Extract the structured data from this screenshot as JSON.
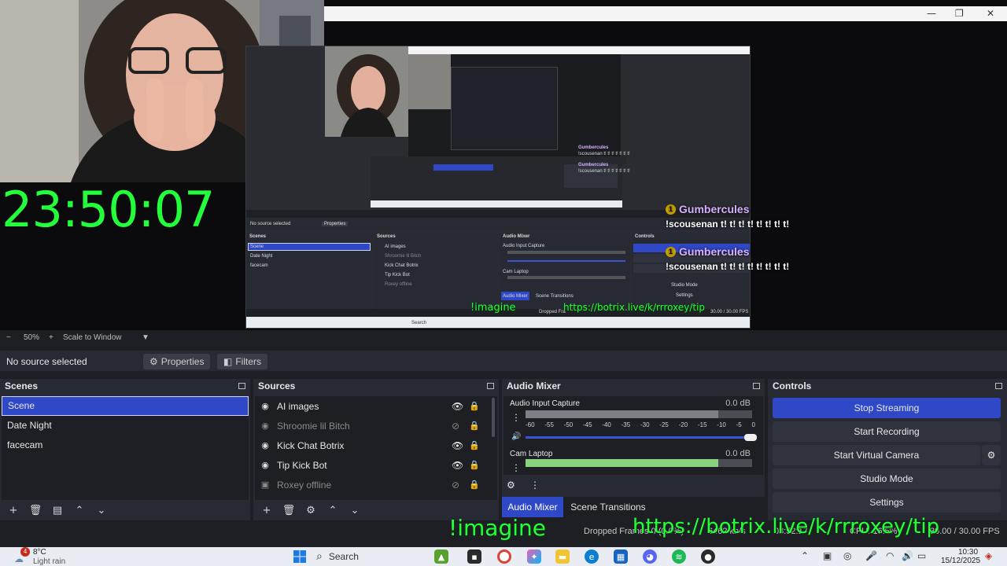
{
  "preview": {
    "clock": "23:50:07",
    "window_controls": {
      "minimize": "—",
      "maximize": "❐",
      "close": "✕"
    },
    "chat": [
      {
        "user": "Gumbercules",
        "badge": "1",
        "message": "!scousenan t! t! t! t! t! t! t! t!"
      },
      {
        "user": "Gumbercules",
        "badge": "1",
        "message": "!scousenan t! t! t! t! t! t! t! t!"
      }
    ],
    "imagine_text": "!imagine",
    "tip_text": "https://botrix.live/k/rrroxey/tip"
  },
  "nested": {
    "no_source": "No source selected",
    "properties": "Properties",
    "scenes_title": "Scenes",
    "sources_title": "Sources",
    "mixer_title": "Audio Mixer",
    "controls_title": "Controls",
    "scenes": [
      "Scene",
      "Date Night",
      "facecam"
    ],
    "sources": [
      "AI images",
      "Shroomie lil Bitch",
      "Kick Chat Botrix",
      "Tip Kick Bot",
      "Roxey offline"
    ],
    "mixer_chans": [
      "Audio Input Capture",
      "Cam Laptop"
    ],
    "tabs": [
      "Audio Mixer",
      "Scene Transitions"
    ],
    "controls": [
      "Studio Mode",
      "Settings"
    ],
    "fps": "30.00 / 30.00 FPS",
    "dropped": "Dropped Fra",
    "search": "Search",
    "chat_user": "Gumbercules",
    "chat_msg": "!scousenan t! t! t! t! t! t! t!"
  },
  "zoombar": {
    "minus": "−",
    "zoom": "50%",
    "plus": "+",
    "scale_mode": "Scale to Window",
    "arrow": "▼"
  },
  "context": {
    "label": "No source selected",
    "properties": "Properties",
    "filters": "Filters"
  },
  "scenes": {
    "title": "Scenes",
    "items": [
      "Scene",
      "Date Night",
      "facecam"
    ],
    "selected": "Scene"
  },
  "sources": {
    "title": "Sources",
    "items": [
      {
        "name": "AI images",
        "visible": true
      },
      {
        "name": "Shroomie lil Bitch",
        "visible": false
      },
      {
        "name": "Kick Chat Botrix",
        "visible": true
      },
      {
        "name": "Tip Kick Bot",
        "visible": true
      },
      {
        "name": "Roxey offline",
        "visible": false
      }
    ]
  },
  "mixer": {
    "title": "Audio Mixer",
    "ticks": [
      "-60",
      "-55",
      "-50",
      "-45",
      "-40",
      "-35",
      "-30",
      "-25",
      "-20",
      "-15",
      "-10",
      "-5",
      "0"
    ],
    "channels": [
      {
        "name": "Audio Input Capture",
        "db": "0.0 dB",
        "level": 0.85
      },
      {
        "name": "Cam Laptop",
        "db": "0.0 dB",
        "level": 0.85
      }
    ],
    "tab_mixer": "Audio Mixer",
    "tab_transitions": "Scene Transitions"
  },
  "controls": {
    "title": "Controls",
    "stop_streaming": "Stop Streaming",
    "start_recording": "Start Recording",
    "start_virtual_camera": "Start Virtual Camera",
    "studio_mode": "Studio Mode",
    "settings": "Settings"
  },
  "status": {
    "dropped_frames": "Dropped Frames 0 (0.0%)",
    "kbps": "6462 kb/s",
    "timer": "03:52:17",
    "cpu": "CPU: 16.5%",
    "fps": "30.00 / 30.00 FPS"
  },
  "taskbar": {
    "weather_temp": "8°C",
    "weather_desc": "Light rain",
    "weather_badge": "4",
    "search": "Search",
    "time": "10:30",
    "date": "15/12/2025"
  },
  "colors": {
    "accent": "#2f48c8",
    "overlay_green": "#23ff3a",
    "dock_bg": "#272a33",
    "chat_name": "#d6b0ff"
  }
}
